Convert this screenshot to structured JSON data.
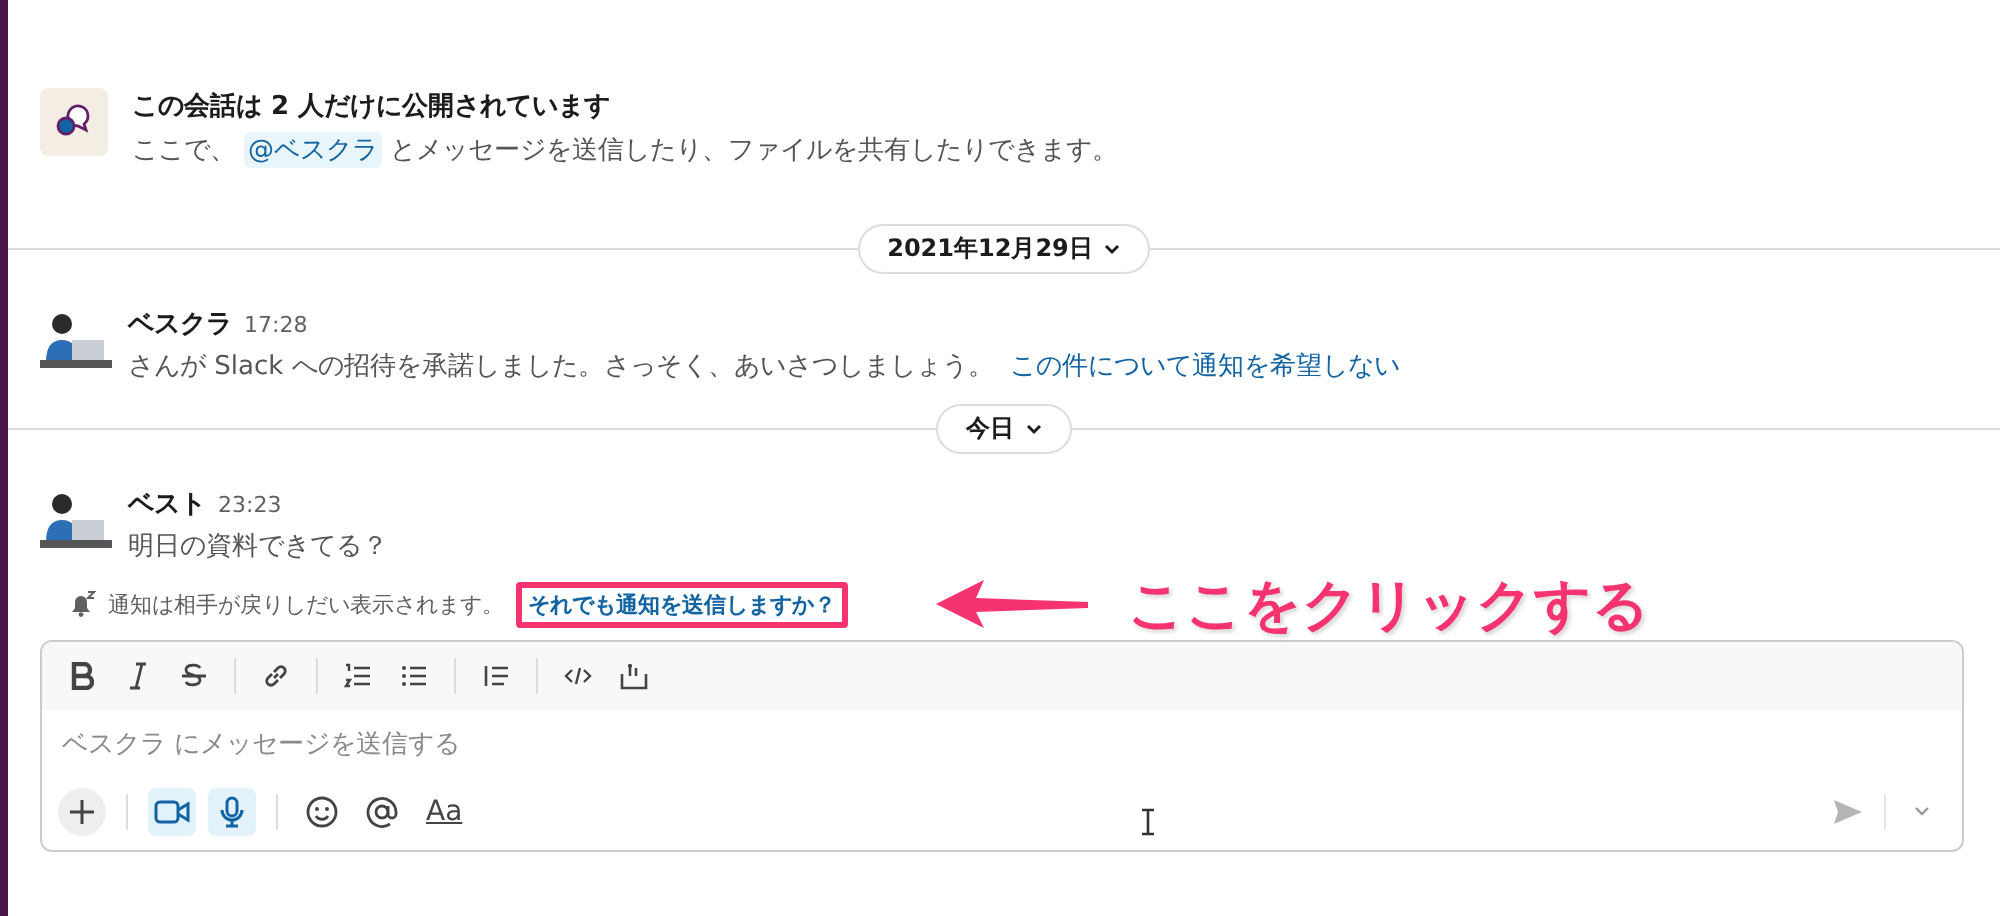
{
  "intro": {
    "title": "この会話は 2 人だけに公開されています",
    "text_before": "ここで、",
    "mention": "@ベスクラ",
    "text_after": "とメッセージを送信したり、ファイルを共有したりできます。"
  },
  "feed": [
    {
      "kind": "date",
      "label": "2021年12月29日"
    },
    {
      "kind": "message",
      "author": "ベスクラ",
      "time": "17:28",
      "text": "さんが Slack への招待を承諾しました。さっそく、あいさつしましょう。",
      "link": "この件について通知を希望しない"
    },
    {
      "kind": "date",
      "label": "今日"
    },
    {
      "kind": "message",
      "author": "ベスト",
      "time": "23:23",
      "text": "明日の資料できてる？"
    }
  ],
  "notice": {
    "text": "通知は相手が戻りしだい表示されます。",
    "link": "それでも通知を送信しますか？"
  },
  "annotation": {
    "label": "ここをクリックする"
  },
  "composer": {
    "placeholder": "ベスクラ にメッセージを送信する",
    "format_label": "Aa",
    "media_buttons": [
      {
        "kind": "video",
        "active": true
      },
      {
        "kind": "mic",
        "active": true
      }
    ]
  }
}
